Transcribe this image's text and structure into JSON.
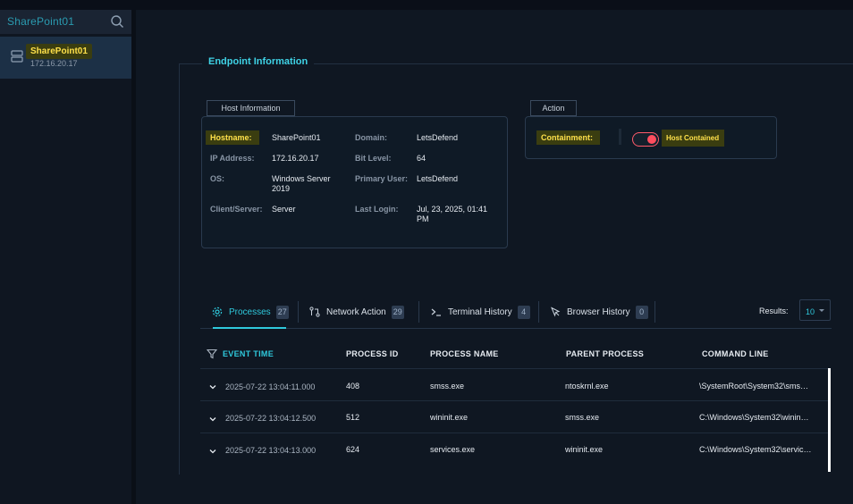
{
  "sidebar": {
    "search_text": "SharePoint01",
    "host": {
      "name": "SharePoint01",
      "ip": "172.16.20.17"
    }
  },
  "endpoint": {
    "title": "Endpoint Information",
    "host_info_label": "Host Information",
    "action_label": "Action",
    "fields": {
      "hostname_label": "Hostname:",
      "hostname": "SharePoint01",
      "ip_label": "IP Address:",
      "ip": "172.16.20.17",
      "os_label": "OS:",
      "os_line1": "Windows Server",
      "os_line2": "2019",
      "client_label": "Client/Server:",
      "client": "Server",
      "domain_label": "Domain:",
      "domain": "LetsDefend",
      "bit_label": "Bit Level:",
      "bit": "64",
      "user_label": "Primary User:",
      "user": "LetsDefend",
      "login_label": "Last Login:",
      "login_line1": "Jul, 23, 2025, 01:41",
      "login_line2": "PM"
    },
    "containment_label": "Containment:",
    "containment_status": "Host Contained",
    "containment_on": true
  },
  "tabs": [
    {
      "label": "Processes",
      "count": "27",
      "icon": "gear-icon"
    },
    {
      "label": "Network Action",
      "count": "29",
      "icon": "network-icon"
    },
    {
      "label": "Terminal History",
      "count": "4",
      "icon": "terminal-icon"
    },
    {
      "label": "Browser History",
      "count": "0",
      "icon": "cursor-icon"
    }
  ],
  "results": {
    "label": "Results:",
    "value": "10"
  },
  "table": {
    "columns": [
      "EVENT TIME",
      "PROCESS ID",
      "PROCESS NAME",
      "PARENT PROCESS",
      "COMMAND LINE"
    ],
    "rows": [
      {
        "time": "2025-07-22 13:04:11.000",
        "pid": "408",
        "name": "smss.exe",
        "parent": "ntoskrnl.exe",
        "cmd": "\\SystemRoot\\System32\\sms…"
      },
      {
        "time": "2025-07-22 13:04:12.500",
        "pid": "512",
        "name": "wininit.exe",
        "parent": "smss.exe",
        "cmd": "C:\\Windows\\System32\\winin…"
      },
      {
        "time": "2025-07-22 13:04:13.000",
        "pid": "624",
        "name": "services.exe",
        "parent": "wininit.exe",
        "cmd": "C:\\Windows\\System32\\servic…"
      }
    ]
  },
  "colors": {
    "accent": "#2fc9dc",
    "highlight": "#ffe14a",
    "danger": "#ff4d5e"
  }
}
